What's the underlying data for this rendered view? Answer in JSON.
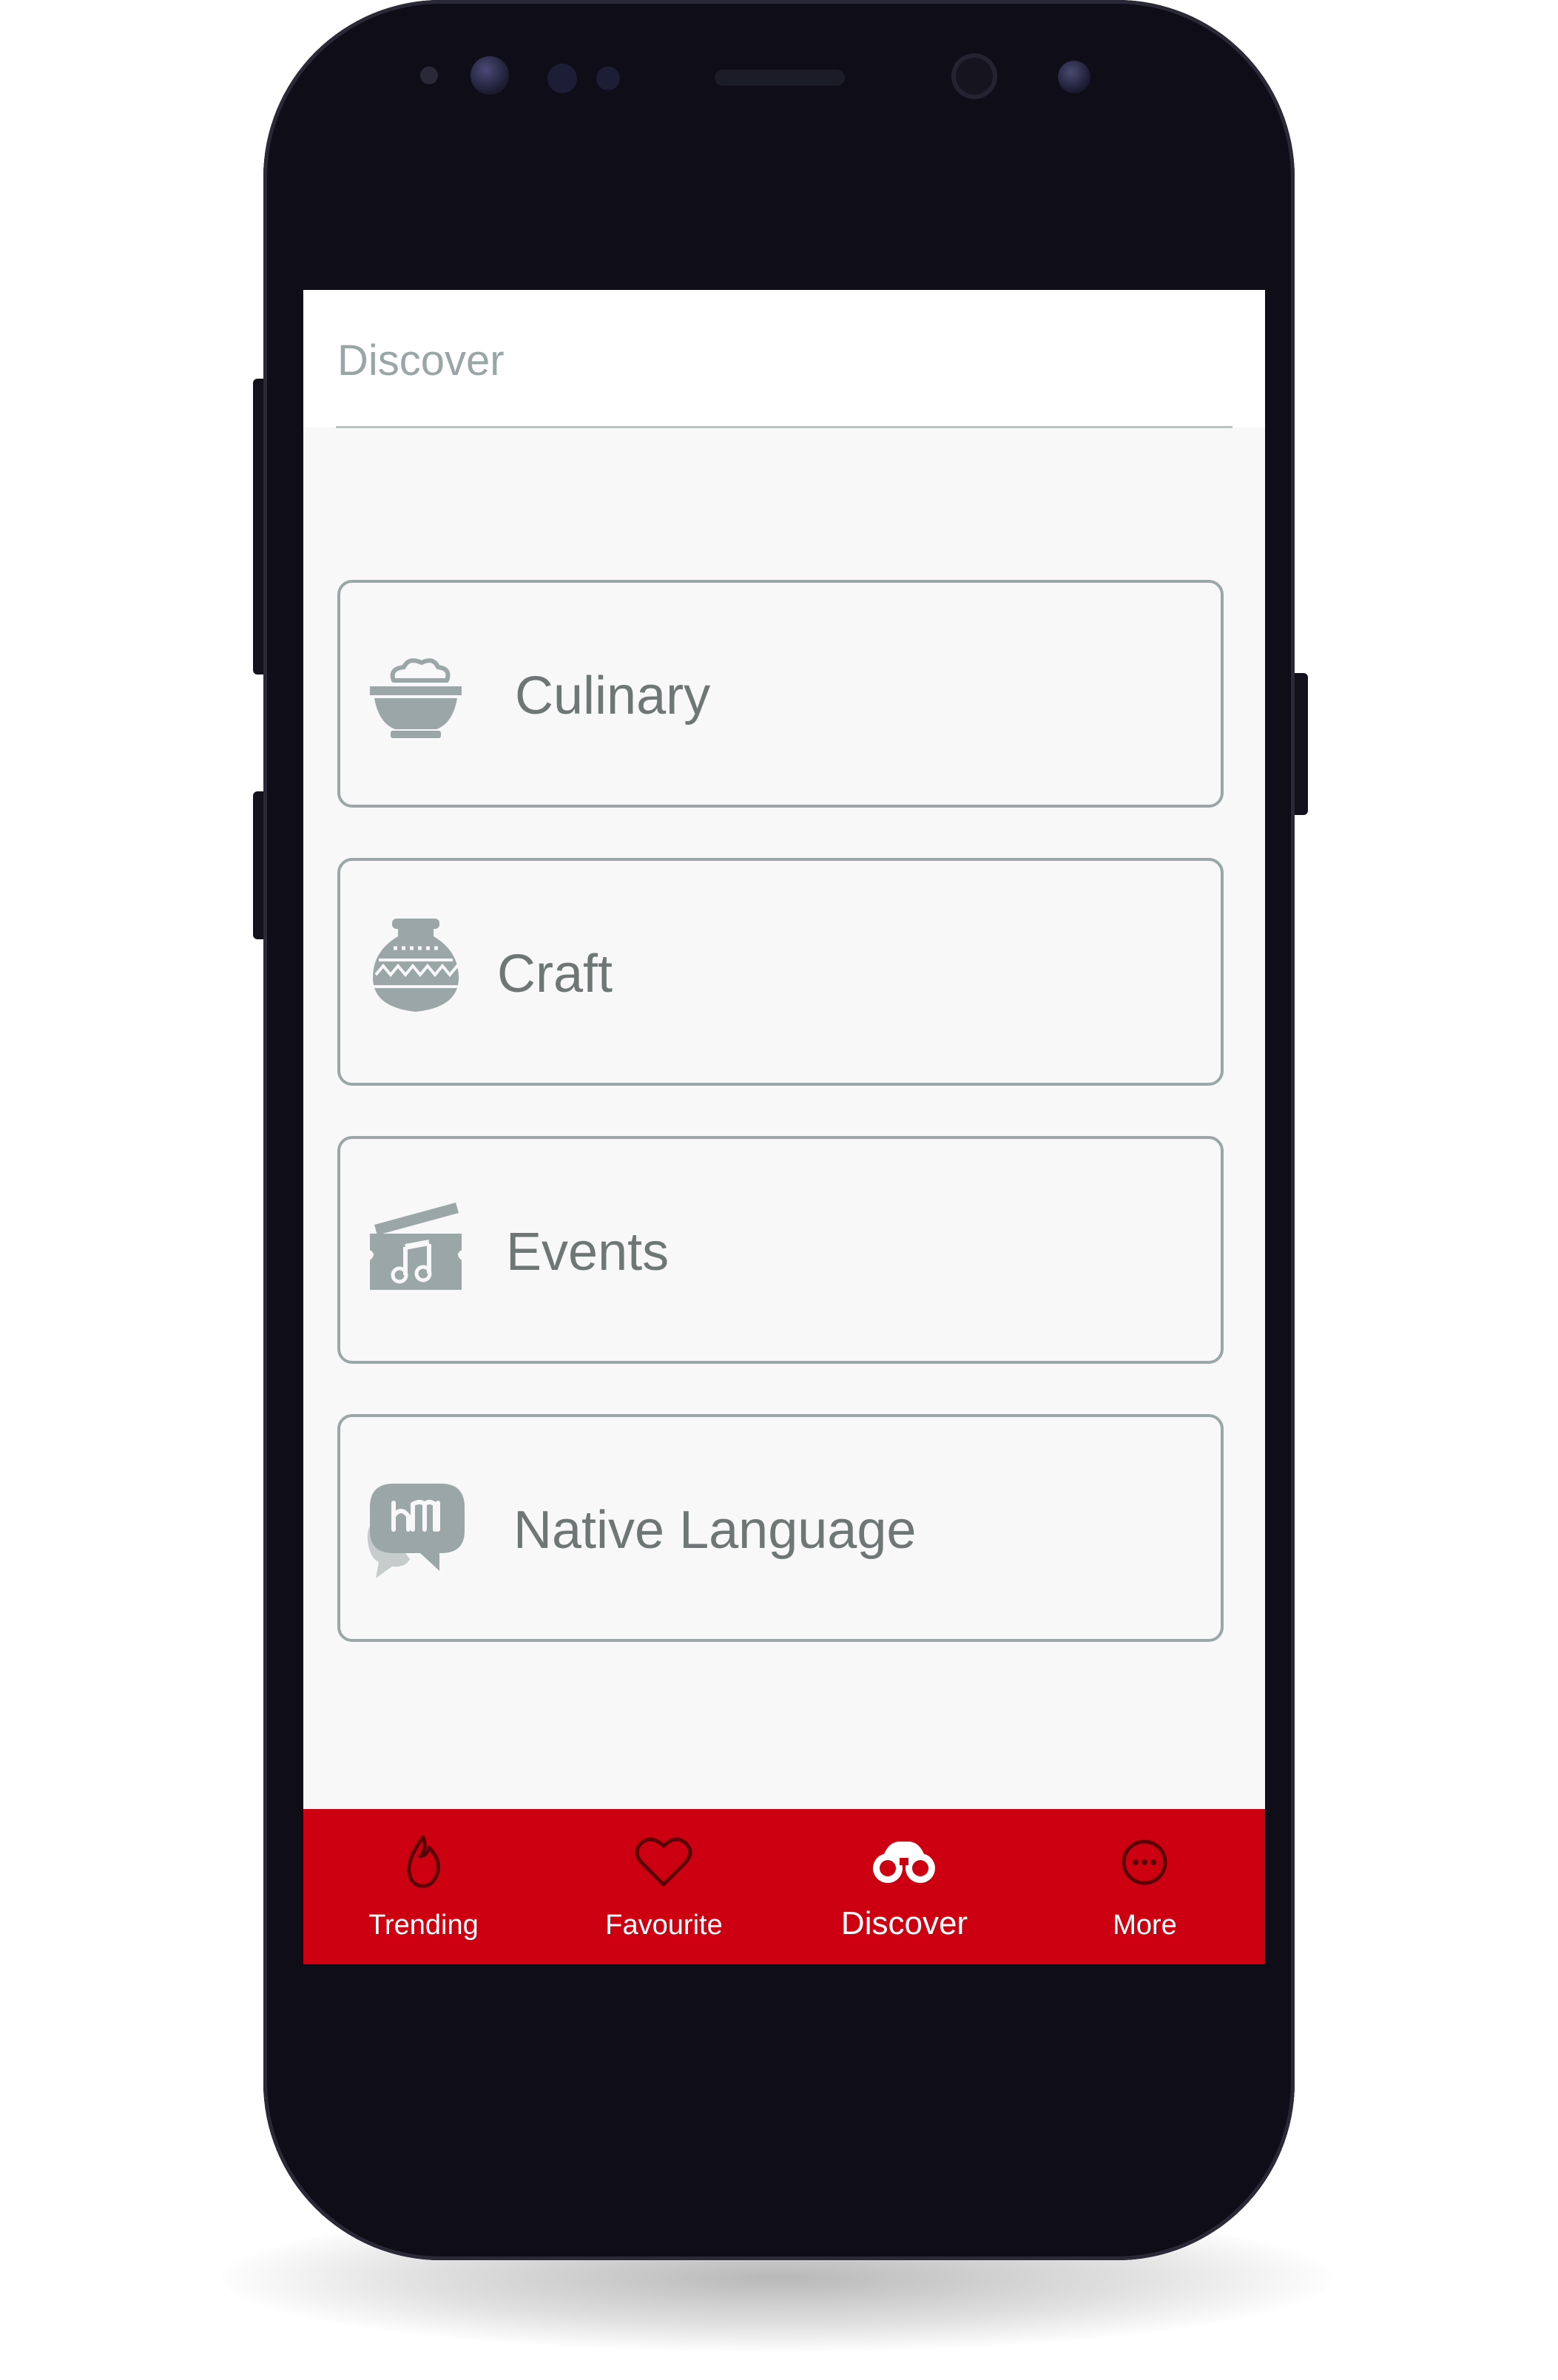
{
  "header": {
    "title": "Discover"
  },
  "categories": [
    {
      "label": "Culinary",
      "icon": "food-bowl-icon"
    },
    {
      "label": "Craft",
      "icon": "clay-pot-icon"
    },
    {
      "label": "Events",
      "icon": "music-ticket-icon"
    },
    {
      "label": "Native Language",
      "icon": "language-chat-icon"
    }
  ],
  "tabbar": {
    "tabs": [
      {
        "label": "Trending",
        "icon": "flame-icon",
        "active": false
      },
      {
        "label": "Favourite",
        "icon": "heart-icon",
        "active": false
      },
      {
        "label": "Discover",
        "icon": "binoculars-icon",
        "active": true
      },
      {
        "label": "More",
        "icon": "more-dots-icon",
        "active": false
      }
    ]
  },
  "colors": {
    "accent": "#cc0011",
    "icon_gray": "#9ba6a6",
    "text_gray": "#6e7676",
    "background": "#f8f8f8"
  }
}
